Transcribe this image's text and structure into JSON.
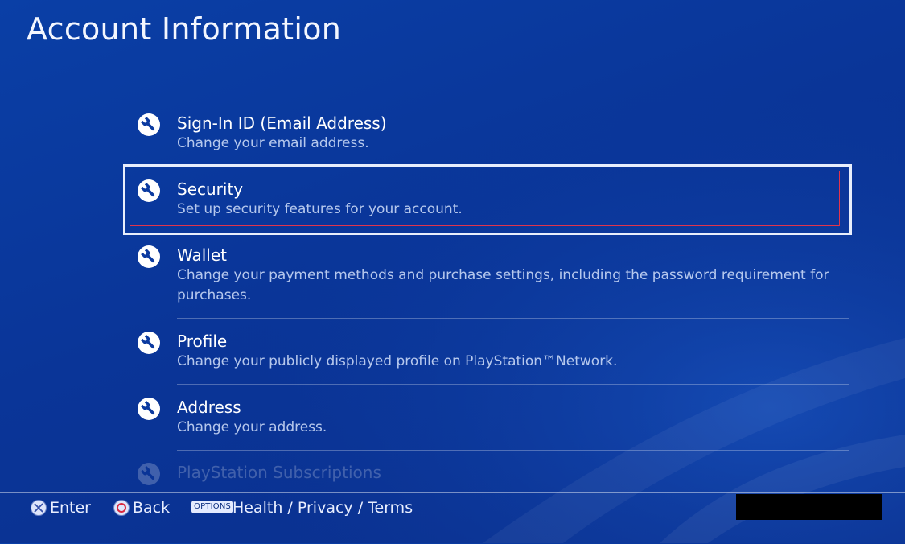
{
  "header": {
    "title": "Account Information"
  },
  "menu": {
    "items": [
      {
        "label": "Sign-In ID (Email Address)",
        "desc": "Change your email address.",
        "icon": "wrench-icon"
      },
      {
        "label": "Security",
        "desc": "Set up security features for your account.",
        "icon": "wrench-icon",
        "selected": true
      },
      {
        "label": "Wallet",
        "desc": "Change your payment methods and purchase settings, including the password requirement for purchases.",
        "icon": "wrench-icon"
      },
      {
        "label": "Profile",
        "desc": "Change your publicly displayed profile on PlayStation™Network.",
        "icon": "wrench-icon"
      },
      {
        "label": "Address",
        "desc": "Change your address.",
        "icon": "wrench-icon"
      },
      {
        "label": "PlayStation Subscriptions",
        "icon": "wrench-icon"
      }
    ]
  },
  "footer": {
    "enter": {
      "label": "Enter",
      "icon": "cross-button-icon"
    },
    "back": {
      "label": "Back",
      "icon": "circle-button-icon"
    },
    "options": {
      "badge": "OPTIONS",
      "label": "Health / Privacy / Terms"
    }
  },
  "colors": {
    "background": "#0b3aa0",
    "focus_frame": "#e8eefc",
    "focus_inner": "#e2344c",
    "text": "#ffffff"
  }
}
